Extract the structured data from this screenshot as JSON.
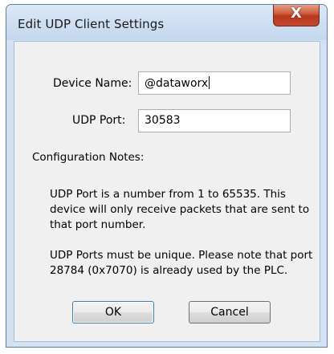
{
  "window": {
    "title": "Edit UDP Client Settings",
    "close_label": "X"
  },
  "form": {
    "device_name_label": "Device Name:",
    "device_name_value": "@dataworx",
    "udp_port_label": "UDP Port:",
    "udp_port_value": "30583"
  },
  "notes": {
    "heading": "Configuration Notes:",
    "paragraph1_lines": [
      "UDP Port is a number from 1 to 65535. This",
      "device will only receive packets that are sent to",
      "that port number."
    ],
    "paragraph2_lines": [
      "UDP Ports must be unique. Please note that port",
      "28784 (0x7070) is already used by the PLC."
    ]
  },
  "buttons": {
    "ok_label": "OK",
    "cancel_label": "Cancel"
  }
}
